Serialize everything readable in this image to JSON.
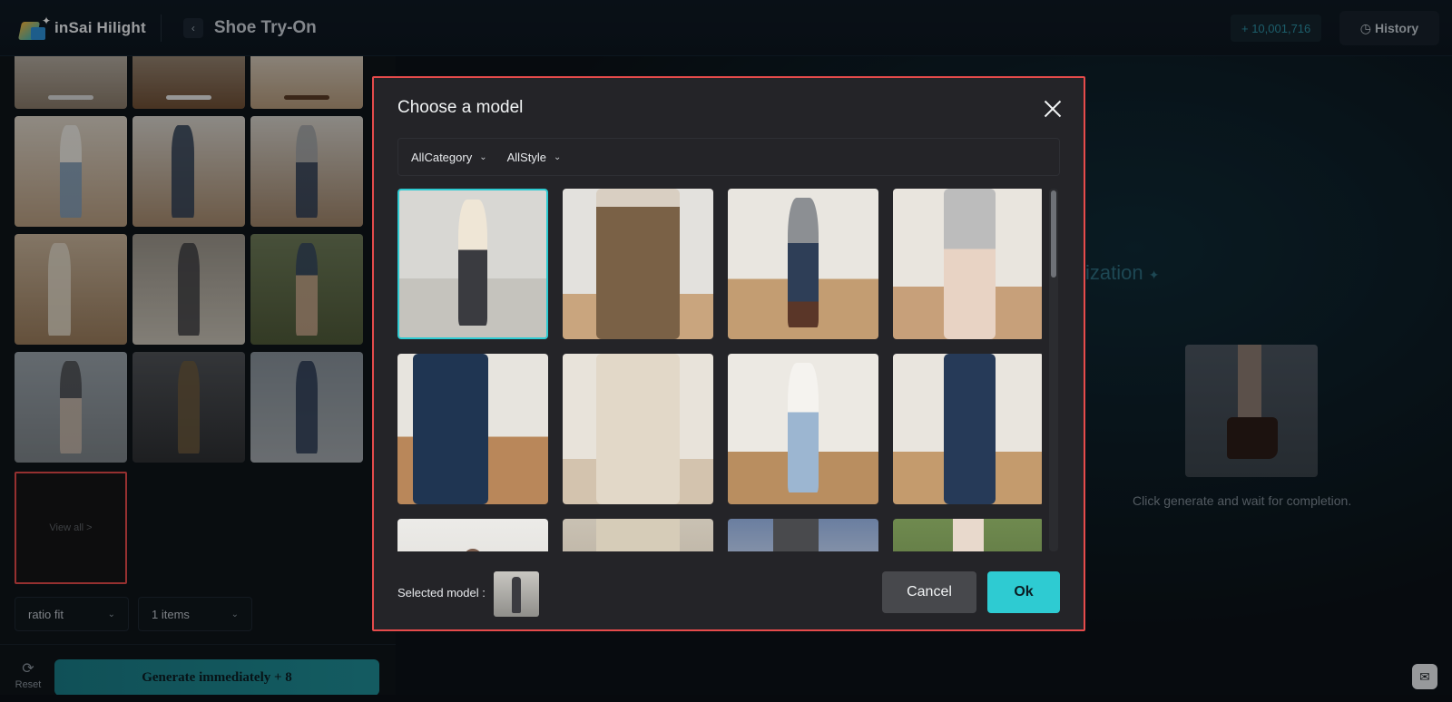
{
  "header": {
    "brand": "inSai Hilight",
    "title": "Shoe Try-On",
    "credits": "+ 10,001,716",
    "history_label": "History"
  },
  "left_panel": {
    "view_all_label": "View all >",
    "ratio_select": "ratio fit",
    "items_select": "1 items",
    "reset_label": "Reset",
    "generate_label": "Generate immediately + 8"
  },
  "right_panel": {
    "heading_fragment": "ization",
    "hint": "Click generate and wait for completion."
  },
  "modal": {
    "title": "Choose a model",
    "filters": [
      "AllCategory",
      "AllStyle"
    ],
    "selected_label": "Selected model :",
    "cancel_label": "Cancel",
    "ok_label": "Ok"
  },
  "colors": {
    "accent": "#2ecbd2",
    "highlight_border": "#e54b4b",
    "modal_bg": "#242428",
    "page_bg": "#0b1016"
  }
}
